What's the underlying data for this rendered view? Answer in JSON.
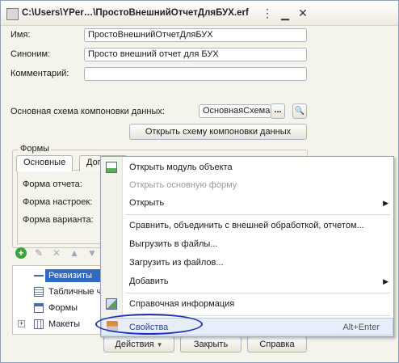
{
  "window": {
    "title": "C:\\Users\\YPer…\\ПростоВнешнийОтчетДляБУХ.erf"
  },
  "fields": {
    "name_label": "Имя:",
    "name_value": "ПростоВнешнийОтчетДляБУХ",
    "synonym_label": "Синоним:",
    "synonym_value": "Просто внешний отчет для БУХ",
    "comment_label": "Комментарий:",
    "comment_value": "",
    "schema_label": "Основная схема компоновки данных:",
    "schema_value": "ОсновнаяСхема"
  },
  "buttons": {
    "open_schema": "Открыть схему компоновки данных",
    "actions": "Действия",
    "close": "Закрыть",
    "help": "Справка",
    "ellipsis": "...",
    "search": "🔍"
  },
  "forms": {
    "group_title": "Формы",
    "tabs": [
      "Основные",
      "Доп"
    ],
    "rows": [
      "Форма отчета:",
      "Форма настроек:",
      "Форма варианта:"
    ]
  },
  "tree": {
    "items": [
      {
        "label": "Реквизиты",
        "icon": "attribute-icon",
        "selected": true
      },
      {
        "label": "Табличные ча",
        "icon": "table-icon"
      },
      {
        "label": "Формы",
        "icon": "form-icon"
      },
      {
        "label": "Макеты",
        "icon": "template-icon"
      }
    ]
  },
  "menu": {
    "items": [
      {
        "label": "Открыть модуль объекта",
        "icon": "module-icon"
      },
      {
        "label": "Открыть основную форму",
        "disabled": true
      },
      {
        "label": "Открыть",
        "submenu": true
      },
      {
        "label": "Сравнить, объединить с внешней обработкой, отчетом..."
      },
      {
        "label": "Выгрузить в файлы..."
      },
      {
        "label": "Загрузить из файлов..."
      },
      {
        "label": "Добавить",
        "submenu": true
      },
      {
        "label": "Справочная информация",
        "icon": "help-info-icon"
      },
      {
        "label": "Свойства",
        "icon": "properties-icon",
        "shortcut": "Alt+Enter",
        "highlighted": true
      }
    ]
  }
}
